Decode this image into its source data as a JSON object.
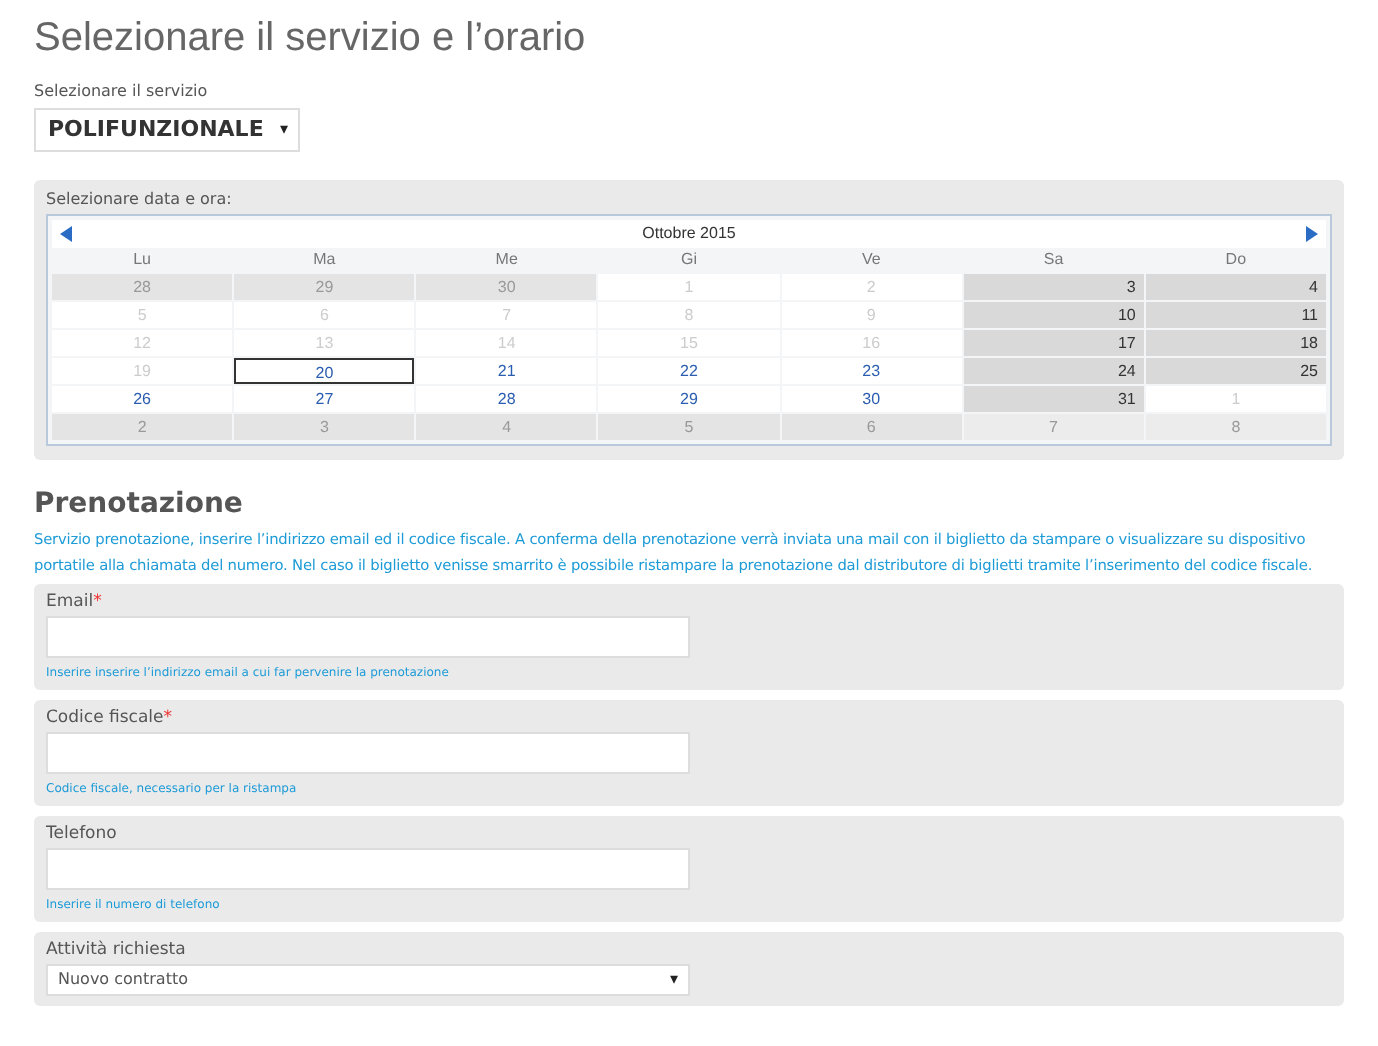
{
  "title": "Selezionare il servizio e l’orario",
  "service": {
    "label": "Selezionare il servizio",
    "value": "POLIFUNZIONALE",
    "caret": "▾"
  },
  "calendar": {
    "label": "Selezionare data e ora:",
    "month": "Ottobre 2015",
    "weekdays": [
      "Lu",
      "Ma",
      "Me",
      "Gi",
      "Ve",
      "Sa",
      "Do"
    ],
    "weeks": [
      [
        {
          "day": "28",
          "kind": "outside",
          "selected": false
        },
        {
          "day": "29",
          "kind": "outside",
          "selected": false
        },
        {
          "day": "30",
          "kind": "outside",
          "selected": false
        },
        {
          "day": "1",
          "kind": "past",
          "selected": false
        },
        {
          "day": "2",
          "kind": "past",
          "selected": false
        },
        {
          "day": "3",
          "kind": "weekend",
          "selected": false
        },
        {
          "day": "4",
          "kind": "weekend",
          "selected": false
        }
      ],
      [
        {
          "day": "5",
          "kind": "past",
          "selected": false
        },
        {
          "day": "6",
          "kind": "past",
          "selected": false
        },
        {
          "day": "7",
          "kind": "past",
          "selected": false
        },
        {
          "day": "8",
          "kind": "past",
          "selected": false
        },
        {
          "day": "9",
          "kind": "past",
          "selected": false
        },
        {
          "day": "10",
          "kind": "weekend",
          "selected": false
        },
        {
          "day": "11",
          "kind": "weekend",
          "selected": false
        }
      ],
      [
        {
          "day": "12",
          "kind": "past",
          "selected": false
        },
        {
          "day": "13",
          "kind": "past",
          "selected": false
        },
        {
          "day": "14",
          "kind": "past",
          "selected": false
        },
        {
          "day": "15",
          "kind": "past",
          "selected": false
        },
        {
          "day": "16",
          "kind": "past",
          "selected": false
        },
        {
          "day": "17",
          "kind": "weekend",
          "selected": false
        },
        {
          "day": "18",
          "kind": "weekend",
          "selected": false
        }
      ],
      [
        {
          "day": "19",
          "kind": "past",
          "selected": false
        },
        {
          "day": "20",
          "kind": "available",
          "selected": true
        },
        {
          "day": "21",
          "kind": "available",
          "selected": false
        },
        {
          "day": "22",
          "kind": "available",
          "selected": false
        },
        {
          "day": "23",
          "kind": "available",
          "selected": false
        },
        {
          "day": "24",
          "kind": "weekend",
          "selected": false
        },
        {
          "day": "25",
          "kind": "weekend",
          "selected": false
        }
      ],
      [
        {
          "day": "26",
          "kind": "available",
          "selected": false
        },
        {
          "day": "27",
          "kind": "available",
          "selected": false
        },
        {
          "day": "28",
          "kind": "available",
          "selected": false
        },
        {
          "day": "29",
          "kind": "available",
          "selected": false
        },
        {
          "day": "30",
          "kind": "available",
          "selected": false
        },
        {
          "day": "31",
          "kind": "weekend",
          "selected": false
        },
        {
          "day": "1",
          "kind": "past",
          "selected": false
        }
      ],
      [
        {
          "day": "2",
          "kind": "outside",
          "selected": false
        },
        {
          "day": "3",
          "kind": "outside",
          "selected": false
        },
        {
          "day": "4",
          "kind": "outside",
          "selected": false
        },
        {
          "day": "5",
          "kind": "outside",
          "selected": false
        },
        {
          "day": "6",
          "kind": "outside",
          "selected": false
        },
        {
          "day": "7",
          "kind": "outside-light",
          "selected": false
        },
        {
          "day": "8",
          "kind": "outside-light",
          "selected": false
        }
      ]
    ]
  },
  "booking": {
    "heading": "Prenotazione",
    "intro": "Servizio prenotazione, inserire l’indirizzo email ed il codice fiscale. A conferma della prenotazione verrà inviata una mail con il biglietto da stampare o visualizzare su dispositivo portatile alla chiamata del numero. Nel caso il biglietto venisse smarrito è possibile ristampare la prenotazione dal distributore di biglietti tramite l’inserimento del codice fiscale.",
    "fields": [
      {
        "kind": "text",
        "label": "Email",
        "required_mark": "*",
        "help": "Inserire inserire l’indirizzo email a cui far pervenire la prenotazione"
      },
      {
        "kind": "text",
        "label": "Codice fiscale",
        "required_mark": "*",
        "help": "Codice fiscale, necessario per la ristampa"
      },
      {
        "kind": "text",
        "label": "Telefono",
        "help": "Inserire il numero di telefono"
      },
      {
        "kind": "select",
        "label": "Attività richiesta",
        "value": "Nuovo contratto",
        "caret": "▾"
      }
    ]
  }
}
